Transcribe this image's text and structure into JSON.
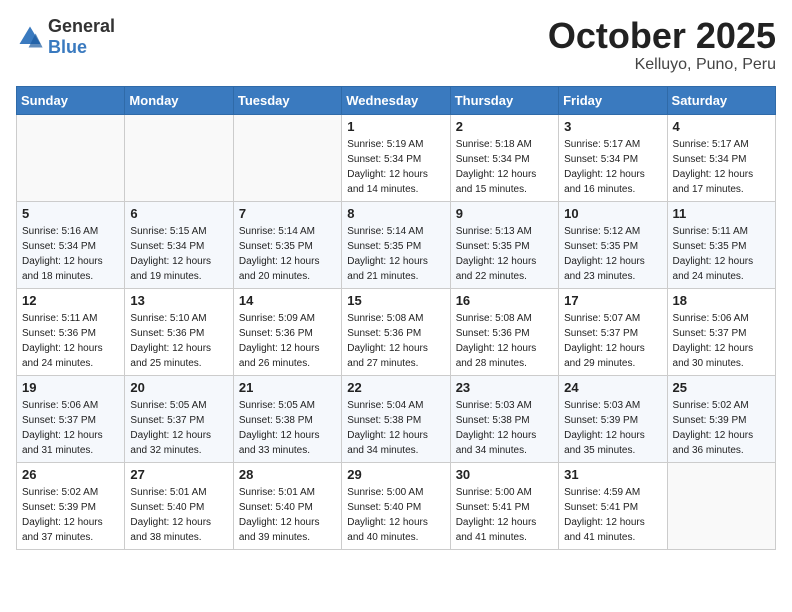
{
  "header": {
    "logo_general": "General",
    "logo_blue": "Blue",
    "month_title": "October 2025",
    "location": "Kelluyo, Puno, Peru"
  },
  "weekdays": [
    "Sunday",
    "Monday",
    "Tuesday",
    "Wednesday",
    "Thursday",
    "Friday",
    "Saturday"
  ],
  "weeks": [
    [
      {
        "day": "",
        "info": ""
      },
      {
        "day": "",
        "info": ""
      },
      {
        "day": "",
        "info": ""
      },
      {
        "day": "1",
        "info": "Sunrise: 5:19 AM\nSunset: 5:34 PM\nDaylight: 12 hours\nand 14 minutes."
      },
      {
        "day": "2",
        "info": "Sunrise: 5:18 AM\nSunset: 5:34 PM\nDaylight: 12 hours\nand 15 minutes."
      },
      {
        "day": "3",
        "info": "Sunrise: 5:17 AM\nSunset: 5:34 PM\nDaylight: 12 hours\nand 16 minutes."
      },
      {
        "day": "4",
        "info": "Sunrise: 5:17 AM\nSunset: 5:34 PM\nDaylight: 12 hours\nand 17 minutes."
      }
    ],
    [
      {
        "day": "5",
        "info": "Sunrise: 5:16 AM\nSunset: 5:34 PM\nDaylight: 12 hours\nand 18 minutes."
      },
      {
        "day": "6",
        "info": "Sunrise: 5:15 AM\nSunset: 5:34 PM\nDaylight: 12 hours\nand 19 minutes."
      },
      {
        "day": "7",
        "info": "Sunrise: 5:14 AM\nSunset: 5:35 PM\nDaylight: 12 hours\nand 20 minutes."
      },
      {
        "day": "8",
        "info": "Sunrise: 5:14 AM\nSunset: 5:35 PM\nDaylight: 12 hours\nand 21 minutes."
      },
      {
        "day": "9",
        "info": "Sunrise: 5:13 AM\nSunset: 5:35 PM\nDaylight: 12 hours\nand 22 minutes."
      },
      {
        "day": "10",
        "info": "Sunrise: 5:12 AM\nSunset: 5:35 PM\nDaylight: 12 hours\nand 23 minutes."
      },
      {
        "day": "11",
        "info": "Sunrise: 5:11 AM\nSunset: 5:35 PM\nDaylight: 12 hours\nand 24 minutes."
      }
    ],
    [
      {
        "day": "12",
        "info": "Sunrise: 5:11 AM\nSunset: 5:36 PM\nDaylight: 12 hours\nand 24 minutes."
      },
      {
        "day": "13",
        "info": "Sunrise: 5:10 AM\nSunset: 5:36 PM\nDaylight: 12 hours\nand 25 minutes."
      },
      {
        "day": "14",
        "info": "Sunrise: 5:09 AM\nSunset: 5:36 PM\nDaylight: 12 hours\nand 26 minutes."
      },
      {
        "day": "15",
        "info": "Sunrise: 5:08 AM\nSunset: 5:36 PM\nDaylight: 12 hours\nand 27 minutes."
      },
      {
        "day": "16",
        "info": "Sunrise: 5:08 AM\nSunset: 5:36 PM\nDaylight: 12 hours\nand 28 minutes."
      },
      {
        "day": "17",
        "info": "Sunrise: 5:07 AM\nSunset: 5:37 PM\nDaylight: 12 hours\nand 29 minutes."
      },
      {
        "day": "18",
        "info": "Sunrise: 5:06 AM\nSunset: 5:37 PM\nDaylight: 12 hours\nand 30 minutes."
      }
    ],
    [
      {
        "day": "19",
        "info": "Sunrise: 5:06 AM\nSunset: 5:37 PM\nDaylight: 12 hours\nand 31 minutes."
      },
      {
        "day": "20",
        "info": "Sunrise: 5:05 AM\nSunset: 5:37 PM\nDaylight: 12 hours\nand 32 minutes."
      },
      {
        "day": "21",
        "info": "Sunrise: 5:05 AM\nSunset: 5:38 PM\nDaylight: 12 hours\nand 33 minutes."
      },
      {
        "day": "22",
        "info": "Sunrise: 5:04 AM\nSunset: 5:38 PM\nDaylight: 12 hours\nand 34 minutes."
      },
      {
        "day": "23",
        "info": "Sunrise: 5:03 AM\nSunset: 5:38 PM\nDaylight: 12 hours\nand 34 minutes."
      },
      {
        "day": "24",
        "info": "Sunrise: 5:03 AM\nSunset: 5:39 PM\nDaylight: 12 hours\nand 35 minutes."
      },
      {
        "day": "25",
        "info": "Sunrise: 5:02 AM\nSunset: 5:39 PM\nDaylight: 12 hours\nand 36 minutes."
      }
    ],
    [
      {
        "day": "26",
        "info": "Sunrise: 5:02 AM\nSunset: 5:39 PM\nDaylight: 12 hours\nand 37 minutes."
      },
      {
        "day": "27",
        "info": "Sunrise: 5:01 AM\nSunset: 5:40 PM\nDaylight: 12 hours\nand 38 minutes."
      },
      {
        "day": "28",
        "info": "Sunrise: 5:01 AM\nSunset: 5:40 PM\nDaylight: 12 hours\nand 39 minutes."
      },
      {
        "day": "29",
        "info": "Sunrise: 5:00 AM\nSunset: 5:40 PM\nDaylight: 12 hours\nand 40 minutes."
      },
      {
        "day": "30",
        "info": "Sunrise: 5:00 AM\nSunset: 5:41 PM\nDaylight: 12 hours\nand 41 minutes."
      },
      {
        "day": "31",
        "info": "Sunrise: 4:59 AM\nSunset: 5:41 PM\nDaylight: 12 hours\nand 41 minutes."
      },
      {
        "day": "",
        "info": ""
      }
    ]
  ]
}
